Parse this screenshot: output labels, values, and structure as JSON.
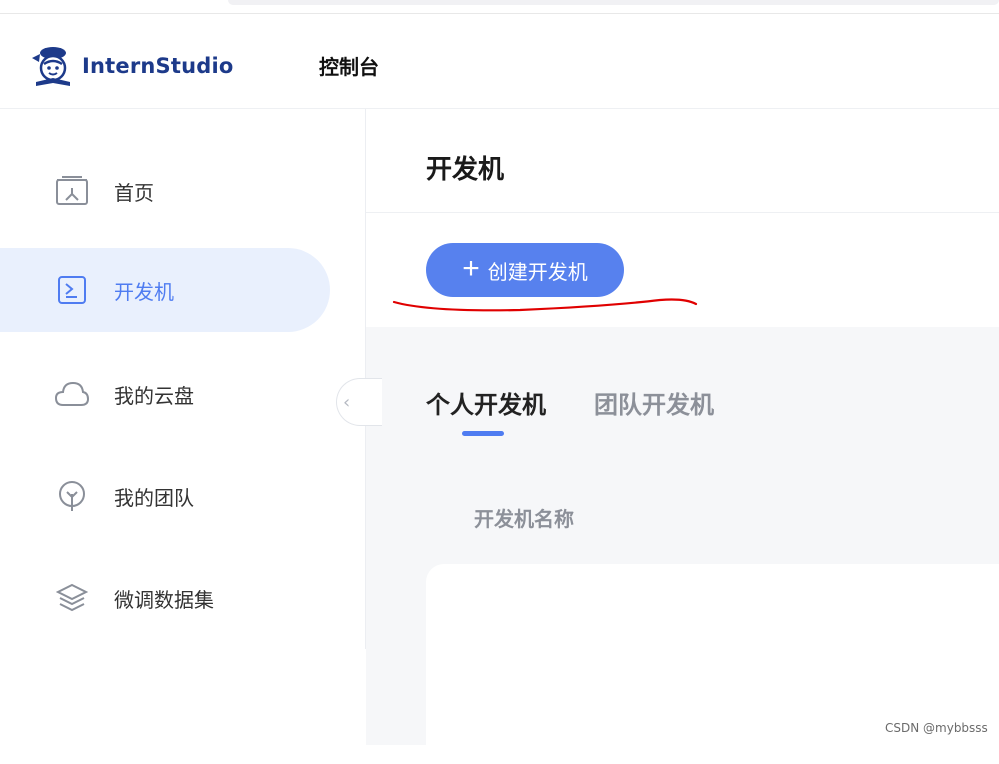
{
  "header": {
    "logo_text": "InternStudio",
    "console_title": "控制台"
  },
  "sidebar": {
    "items": [
      {
        "label": "首页",
        "icon": "home-icon"
      },
      {
        "label": "开发机",
        "icon": "terminal-icon",
        "active": true
      },
      {
        "label": "我的云盘",
        "icon": "cloud-icon"
      },
      {
        "label": "我的团队",
        "icon": "tree-icon"
      },
      {
        "label": "微调数据集",
        "icon": "layers-icon"
      }
    ],
    "collapse_icon": "chevron-left-icon"
  },
  "main": {
    "page_title": "开发机",
    "create_button": {
      "label": "创建开发机",
      "icon": "plus-icon"
    },
    "tabs": [
      {
        "label": "个人开发机",
        "active": true
      },
      {
        "label": "团队开发机",
        "active": false
      }
    ],
    "table": {
      "columns": [
        "开发机名称"
      ]
    }
  },
  "watermark": "CSDN @mybbsss",
  "colors": {
    "accent": "#4f7cf1",
    "button": "#5781ee",
    "active_bg": "#e9f0fd",
    "annotation": "#e00000"
  }
}
